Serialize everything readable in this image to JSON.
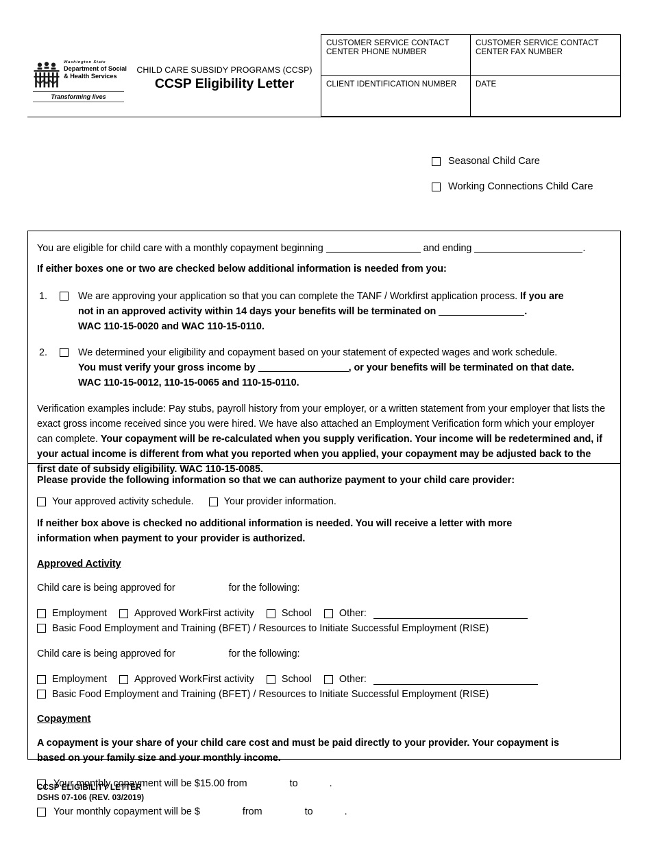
{
  "document": {
    "agency_logo": {
      "state_line": "Washington State",
      "dept_line1": "Department of Social",
      "dept_line2": "& Health Services",
      "tagline": "Transforming lives"
    },
    "title_small": "CHILD CARE SUBSIDY PROGRAMS (CCSP)",
    "title_large": "CCSP Eligibility Letter"
  },
  "header_table": {
    "cell_phone": "CUSTOMER SERVICE CONTACT CENTER PHONE NUMBER",
    "cell_fax": "CUSTOMER SERVICE CONTACT CENTER FAX NUMBER",
    "cell_client_id": "CLIENT IDENTIFICATION NUMBER",
    "cell_date": "DATE",
    "value_phone": "",
    "value_fax": "",
    "value_client_id": "",
    "value_date": ""
  },
  "program_checkboxes": [
    {
      "label": "Seasonal Child Care",
      "checked": false
    },
    {
      "label": "Working Connections Child Care",
      "checked": false
    }
  ],
  "eligibility": {
    "lead_part1": "You are eligible for child care with a monthly copayment beginning",
    "lead_part2": "and ending",
    "lead_part3": ".",
    "beginning_value": "",
    "ending_value": "",
    "condition_note": "If either boxes one or two are checked below additional information is needed from you:"
  },
  "numbered_items": [
    {
      "number": "1.",
      "checked": false,
      "line1_normal": "We are approving your application so that you can complete the TANF / Workfirst application process. ",
      "line1_bold": "If you are",
      "line2_bold_a": "not in an approved activity within 14 days your benefits will be terminated on",
      "line2_blank": "",
      "line2_bold_b": ".",
      "line3_bold": "WAC 110-15-0020 and WAC 110-15-0110."
    },
    {
      "number": "2.",
      "checked": false,
      "line1_normal": "We determined your eligibility and copayment based on your statement of expected wages and work schedule.",
      "line2_bold_a": "You must verify your gross income by",
      "line2_blank": "",
      "line2_bold_b": ", or your benefits will be terminated on that date.",
      "line3_bold": "WAC 110-15-0012, 110-15-0065 and 110-15-0110."
    }
  ],
  "verification": {
    "normal_text": "Verification examples include:  Pay stubs, payroll history from your employer, or a written statement from your employer that lists the exact gross income received since you were hired. We have also attached an Employment Verification form which your employer can complete.  ",
    "bold_text": "Your copayment will be re-calculated when you supply verification.  Your income will be redetermined and, if your actual income is different from what you reported when you applied, your copayment may be adjusted back to the first date of subsidy eligibility.  WAC 110-15-0085."
  },
  "provider_section": {
    "heading": "Please provide the following information so that we can authorize payment to your child care provider:",
    "options": [
      {
        "label": "Your approved activity schedule.",
        "checked": false
      },
      {
        "label": "Your provider information.",
        "checked": false
      }
    ],
    "note_line1": "If neither box above is checked no additional information is needed.  You will receive a letter with more",
    "note_line2": "information when payment to your provider is authorized."
  },
  "approved_activity": {
    "heading": "Approved Activity",
    "blocks": [
      {
        "lead_a": "Child care is being approved for",
        "child_name": "",
        "lead_b": "for the following:",
        "options": [
          {
            "label": "Employment",
            "checked": false
          },
          {
            "label": "Approved WorkFirst activity",
            "checked": false
          },
          {
            "label": "School",
            "checked": false
          },
          {
            "label": "Other:",
            "checked": false
          }
        ],
        "other_value": "",
        "bfet": {
          "label": "Basic Food Employment and Training (BFET) / Resources to Initiate Successful Employment (RISE)",
          "checked": false
        }
      },
      {
        "lead_a": "Child care is being approved for",
        "child_name": "",
        "lead_b": "for the following:",
        "options": [
          {
            "label": "Employment",
            "checked": false
          },
          {
            "label": "Approved WorkFirst activity",
            "checked": false
          },
          {
            "label": "School",
            "checked": false
          },
          {
            "label": "Other:",
            "checked": false
          }
        ],
        "other_value": "",
        "bfet": {
          "label": "Basic Food Employment and Training (BFET) / Resources to Initiate Successful Employment (RISE)",
          "checked": false
        }
      }
    ]
  },
  "copayment": {
    "heading": "Copayment",
    "note_line1": "A copayment is your share of your child care cost and must be paid directly to your provider.  Your copayment is",
    "note_line2": "based on your family size and your monthly income.",
    "rows": [
      {
        "checked": false,
        "part1": "Your monthly copayment will be $15.00 from",
        "from_value": "",
        "part2": "to",
        "to_value": "",
        "part3": "."
      },
      {
        "checked": false,
        "part1": "Your monthly copayment will be $",
        "amount_value": "",
        "part2": "from",
        "from_value": "",
        "part3": "to",
        "to_value": "",
        "part4": "."
      }
    ]
  },
  "footer": {
    "line1": "CCSP ELIGIBILITY LETTER",
    "line2": "DSHS 07-106 (REV. 03/2019)"
  },
  "colors": {
    "ink": "#000000",
    "paper": "#ffffff",
    "rule": "#555555"
  }
}
